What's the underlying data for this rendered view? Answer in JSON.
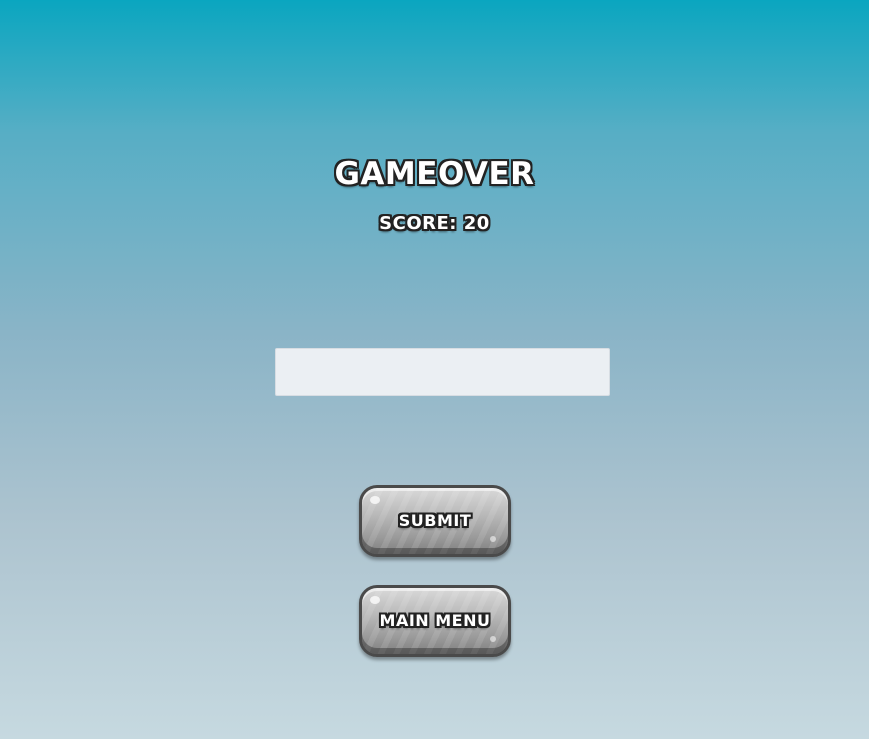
{
  "game_over": {
    "title": "GAMEOVER",
    "score_label": "SCORE:",
    "score_value": "20"
  },
  "name_input": {
    "value": "",
    "placeholder": ""
  },
  "buttons": {
    "submit_label": "SUBMIT",
    "main_menu_label": "MAIN MENU"
  },
  "colors": {
    "background_top": "#0aa6c0",
    "background_bottom": "#c6d9e0",
    "input_background": "#ebeff3",
    "button_face": "#b9b9b9",
    "text_fill": "#ffffff",
    "text_outline": "#222222"
  }
}
